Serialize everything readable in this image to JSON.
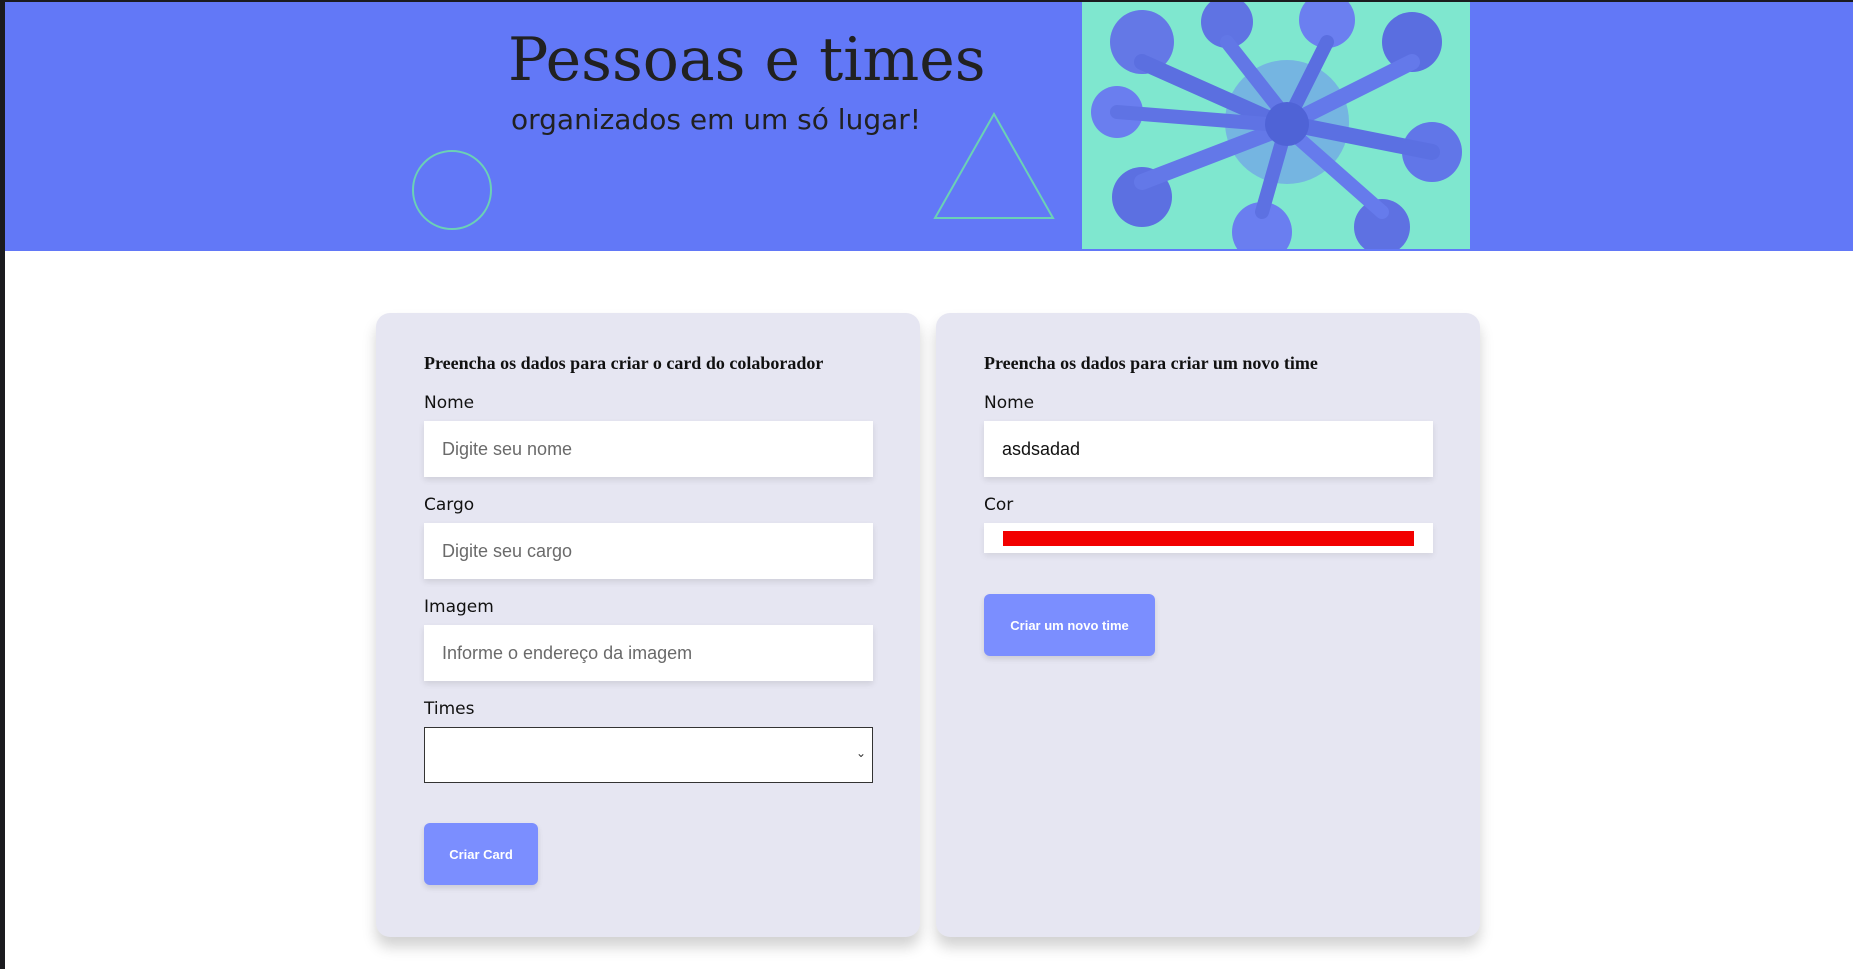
{
  "banner": {
    "title": "Pessoas e times",
    "subtitle": "organizados em um só lugar!",
    "photo_alt": "team-hands-together-photo"
  },
  "collaborator_form": {
    "heading": "Preencha os dados para criar o card do colaborador",
    "name_label": "Nome",
    "name_placeholder": "Digite seu nome",
    "role_label": "Cargo",
    "role_placeholder": "Digite seu cargo",
    "image_label": "Imagem",
    "image_placeholder": "Informe o endereço da imagem",
    "teams_label": "Times",
    "teams_selected": "",
    "submit_label": "Criar Card"
  },
  "team_form": {
    "heading": "Preencha os dados para criar um novo time",
    "name_label": "Nome",
    "name_value": "asdsadad",
    "color_label": "Cor",
    "color_value": "#f20000",
    "submit_label": "Criar um novo time"
  },
  "colors": {
    "banner": "#6278f7",
    "accent_button": "#7b8eff",
    "card_bg": "#e6e6f2",
    "decor_stroke": "#6bd1b5",
    "photo_tint": "#7fe7cf"
  }
}
